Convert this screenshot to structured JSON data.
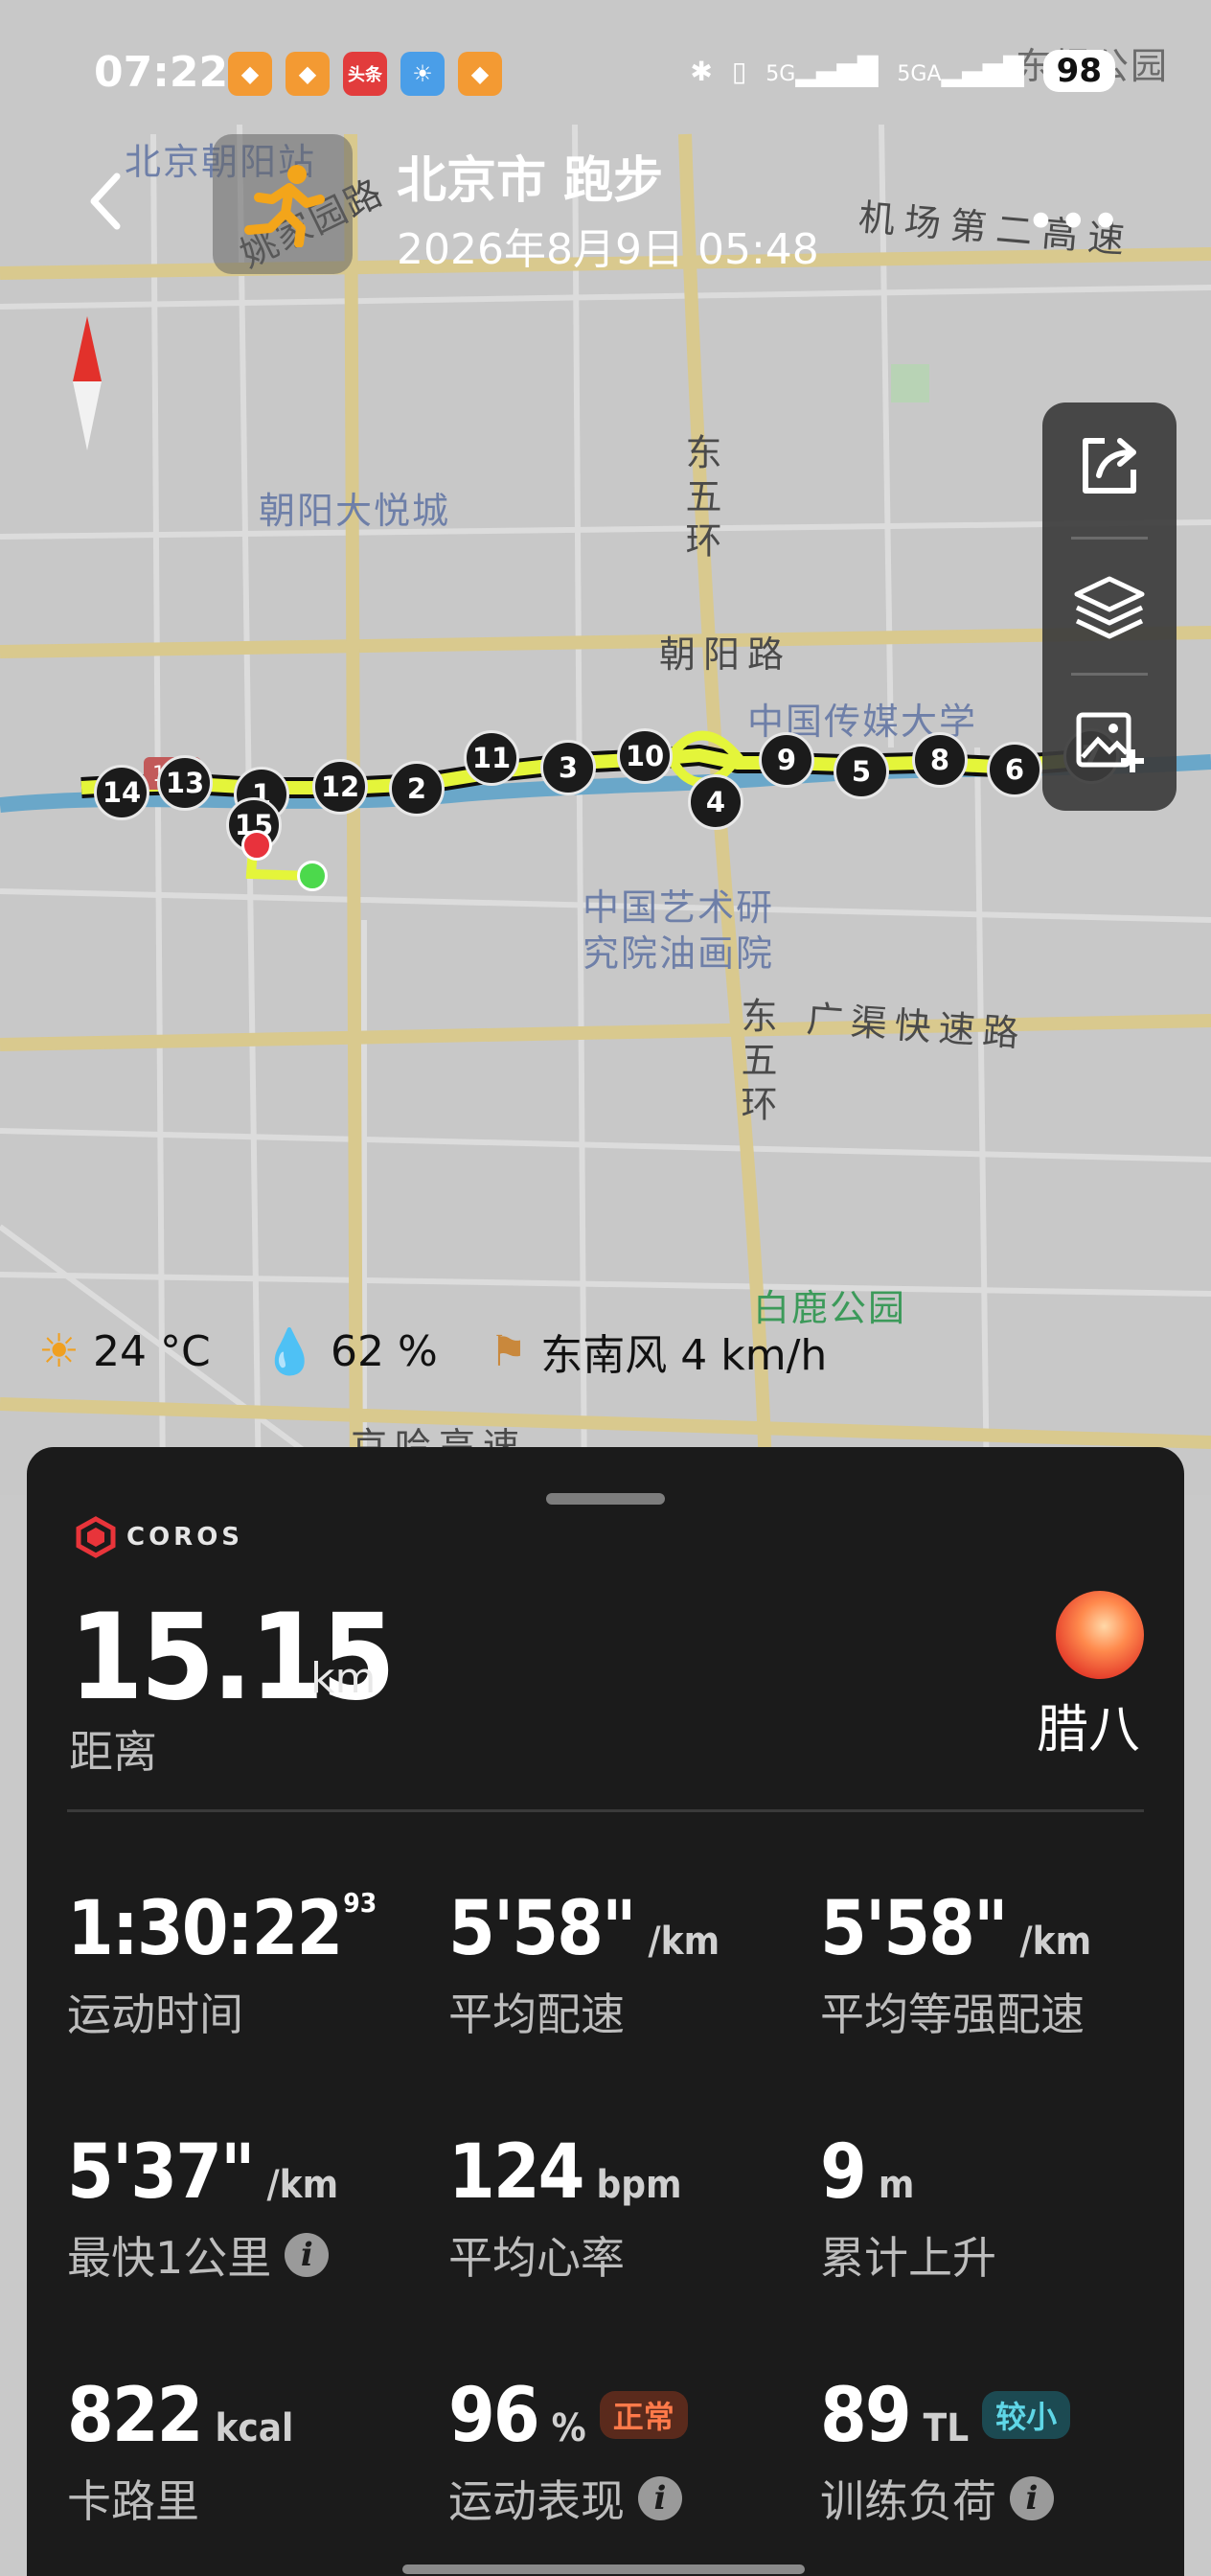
{
  "status_bar": {
    "time": "07:22",
    "app_icons": [
      "app-icon",
      "app-icon",
      "头条",
      "weather-icon",
      "app-icon"
    ],
    "signal_1": "5G",
    "signal_2": "5GA",
    "battery": "98"
  },
  "header": {
    "title": "北京市 跑步",
    "subtitle": "2026年8月9日 05:48",
    "more": "•••"
  },
  "map": {
    "labels": {
      "station": "北京朝阳站",
      "yaojia_road": "姚家园路",
      "airport_expressway": "机场第二高速",
      "joy_city": "朝阳大悦城",
      "east5_top": "东五环",
      "chaoyang_road": "朝阳路",
      "cuc": "中国传媒大学",
      "art_academy_1": "中国艺术研",
      "art_academy_2": "究院油画院",
      "guangqu": "广渠快速路",
      "east5_bottom": "东五环",
      "bailu_park": "白鹿公园",
      "jingha": "京哈高速",
      "top_right": "东坝公园",
      "road_sign": "102"
    },
    "km_markers": [
      "14",
      "13",
      "1",
      "15",
      "12",
      "2",
      "11",
      "3",
      "10",
      "4",
      "9",
      "5",
      "8",
      "6",
      "7"
    ],
    "route_color": "#e4f53a",
    "start_color": "#4cd94c",
    "end_color": "#e8323c"
  },
  "toolbar": {
    "share": "share-icon",
    "layers": "layers-icon",
    "add_image": "add-image-icon"
  },
  "weather": {
    "temperature": "24 °C",
    "humidity": "62  %",
    "wind": "东南风 4 km/h"
  },
  "card": {
    "brand": "COROS",
    "distance": "15.15",
    "distance_unit": "km",
    "distance_label": "距离",
    "user_name": "腊八",
    "stats": [
      {
        "value": "1:30:22",
        "sup": "93",
        "unit": "",
        "label": "运动时间",
        "info": false
      },
      {
        "value": "5'58\"",
        "unit": "/km",
        "label": "平均配速",
        "info": false
      },
      {
        "value": "5'58\"",
        "unit": "/km",
        "label": "平均等强配速",
        "info": false
      },
      {
        "value": "5'37\"",
        "unit": "/km",
        "label": "最快1公里",
        "info": true
      },
      {
        "value": "124",
        "unit": "bpm",
        "label": "平均心率",
        "info": false
      },
      {
        "value": "9",
        "unit": "m",
        "label": "累计上升",
        "info": false
      },
      {
        "value": "822",
        "unit": "kcal",
        "label": "卡路里",
        "info": false
      },
      {
        "value": "96",
        "unit": "%",
        "badge": "正常",
        "label": "运动表现",
        "info": true
      },
      {
        "value": "89",
        "unit": "TL",
        "badge": "较小",
        "label": "训练负荷",
        "info": true
      }
    ],
    "info_glyph": "i"
  }
}
